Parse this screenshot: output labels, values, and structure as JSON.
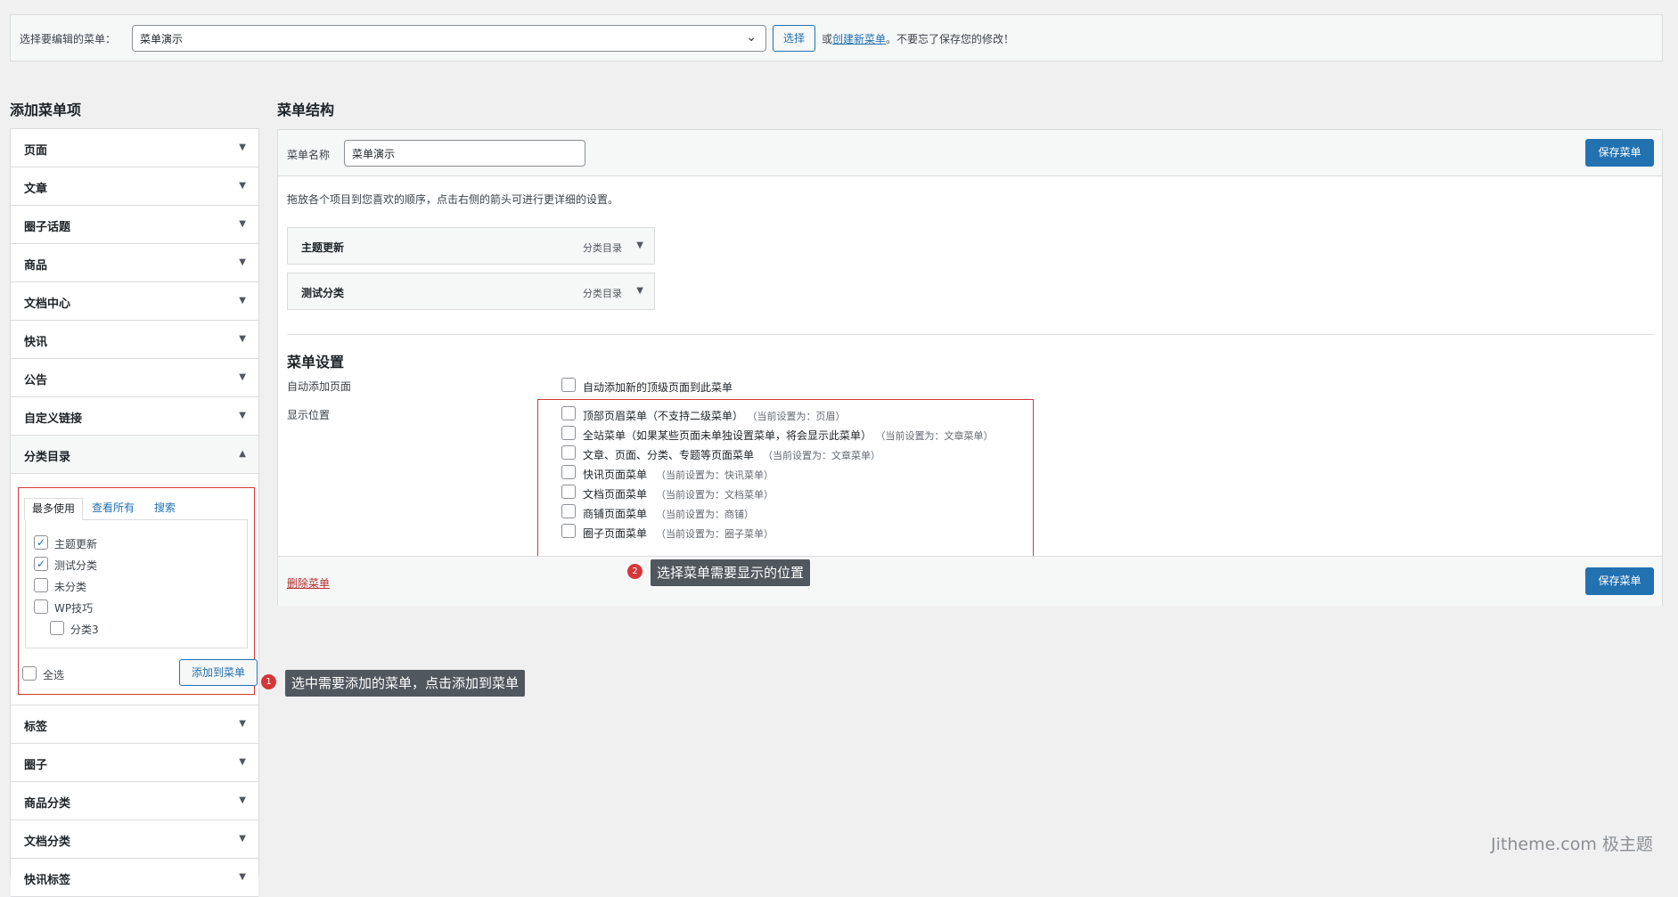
{
  "topbar": {
    "select_label": "选择要编辑的菜单：",
    "selected_menu": "菜单演示",
    "select_button": "选择",
    "note_prefix": "或",
    "create_link": "创建新菜单",
    "note_suffix": "。不要忘了保存您的修改！"
  },
  "left": {
    "heading": "添加菜单项",
    "items_before": [
      "页面",
      "文章",
      "圈子话题",
      "商品",
      "文档中心",
      "快讯",
      "公告",
      "自定义链接"
    ],
    "open_section": "分类目录",
    "tabs": [
      "最多使用",
      "查看所有",
      "搜索"
    ],
    "categories": [
      {
        "label": "主题更新",
        "checked": true
      },
      {
        "label": "测试分类",
        "checked": true
      },
      {
        "label": "未分类",
        "checked": false
      },
      {
        "label": "WP技巧",
        "checked": false
      },
      {
        "label": "分类3",
        "checked": false
      }
    ],
    "select_all": "全选",
    "add_button": "添加到菜单",
    "items_after": [
      "标签",
      "圈子",
      "商品分类",
      "文档分类",
      "快讯标签"
    ]
  },
  "right": {
    "heading": "菜单结构",
    "name_label": "菜单名称",
    "name_value": "菜单演示",
    "save_button": "保存菜单",
    "instructions": "拖放各个项目到您喜欢的顺序，点击右侧的箭头可进行更详细的设置。",
    "menu_items": [
      {
        "title": "主题更新",
        "type": "分类目录"
      },
      {
        "title": "测试分类",
        "type": "分类目录"
      }
    ],
    "settings_heading": "菜单设置",
    "auto_add_label": "自动添加页面",
    "auto_add_option": "自动添加新的顶级页面到此菜单",
    "locations_label": "显示位置",
    "locations": [
      {
        "label": "顶部页眉菜单（不支持二级菜单）",
        "current": "（当前设置为：页眉）"
      },
      {
        "label": "全站菜单（如果某些页面未单独设置菜单，将会显示此菜单）",
        "current": "（当前设置为：文章菜单）"
      },
      {
        "label": "文章、页面、分类、专题等页面菜单",
        "current": "（当前设置为：文章菜单）"
      },
      {
        "label": "快讯页面菜单",
        "current": "（当前设置为：快讯菜单）"
      },
      {
        "label": "文档页面菜单",
        "current": "（当前设置为：文档菜单）"
      },
      {
        "label": "商铺页面菜单",
        "current": "（当前设置为：商铺）"
      },
      {
        "label": "圈子页面菜单",
        "current": "（当前设置为：圈子菜单）"
      }
    ],
    "delete_link": "删除菜单"
  },
  "annotations": [
    {
      "number": "1",
      "text": "选中需要添加的菜单，点击添加到菜单"
    },
    {
      "number": "2",
      "text": "选择菜单需要显示的位置"
    }
  ],
  "watermark": "Jitheme.com 极主题",
  "colors": {
    "primary": "#2271b1",
    "highlight_box": "#d63638",
    "background": "#f0f0f1"
  }
}
